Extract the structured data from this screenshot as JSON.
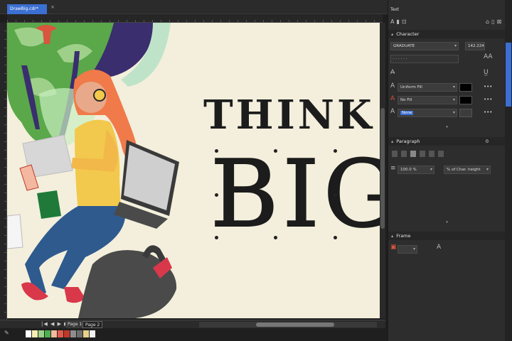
{
  "document": {
    "tab_label": "DrawBig.cdr*",
    "close_glyph": "×"
  },
  "canvas": {
    "headline_line1": "THINK",
    "headline_line2": "BIG"
  },
  "pages": {
    "nav_glyphs": "|◀ ◀ ▶ ▶| ⊞",
    "tabs": [
      "Page 1",
      "Page 2"
    ]
  },
  "palette": [
    "#ffffff",
    "#f6eeb4",
    "#9fd08a",
    "#4caf50",
    "#f4b8a0",
    "#e05a4a",
    "#c0392b",
    "#8e8e8e",
    "#6d6d6d",
    "#e8d28a",
    "#f2f2f2"
  ],
  "panel": {
    "title": "Text",
    "character": {
      "header": "Character",
      "font": "GRADUATE",
      "size": "142.224",
      "style": "· · · · · ·",
      "fill_type": "Uniform Fill",
      "bg_fill_type": "No Fill",
      "outline": "None"
    },
    "paragraph": {
      "header": "Paragraph",
      "value": "0",
      "line_spacing": "100.0 %",
      "spacing_unit": "% of Char. height"
    },
    "frame": {
      "header": "Frame"
    }
  },
  "colors": {
    "accent": "#3b6fd1",
    "canvas_bg": "#f3efdc",
    "panel_bg": "#2d2d2d"
  }
}
